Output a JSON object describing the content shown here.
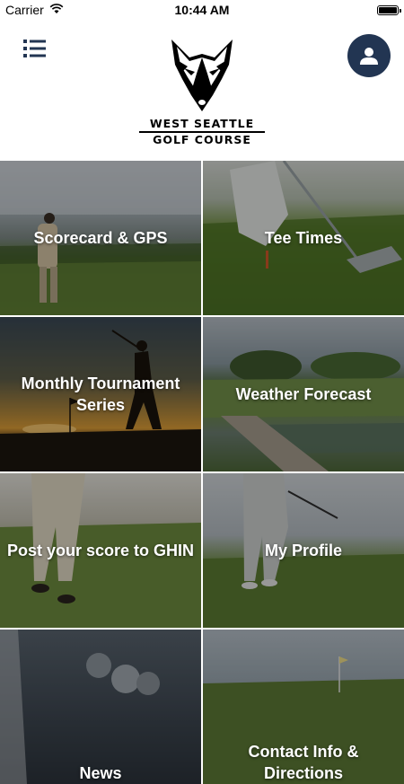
{
  "status_bar": {
    "carrier": "Carrier",
    "time": "10:44 AM",
    "battery_level": 1.0
  },
  "header": {
    "menu_icon": "list-icon",
    "profile_icon": "user-icon",
    "profile_color": "#223552",
    "logo_line1": "WEST SEATTLE",
    "logo_line2": "GOLF COURSE"
  },
  "tiles": [
    {
      "label": "Scorecard & GPS"
    },
    {
      "label": "Tee Times"
    },
    {
      "label": "Monthly Tournament Series"
    },
    {
      "label": "Weather Forecast"
    },
    {
      "label": "Post your score to GHIN"
    },
    {
      "label": "My Profile"
    },
    {
      "label": "News"
    },
    {
      "label": "Contact Info & Directions"
    }
  ]
}
